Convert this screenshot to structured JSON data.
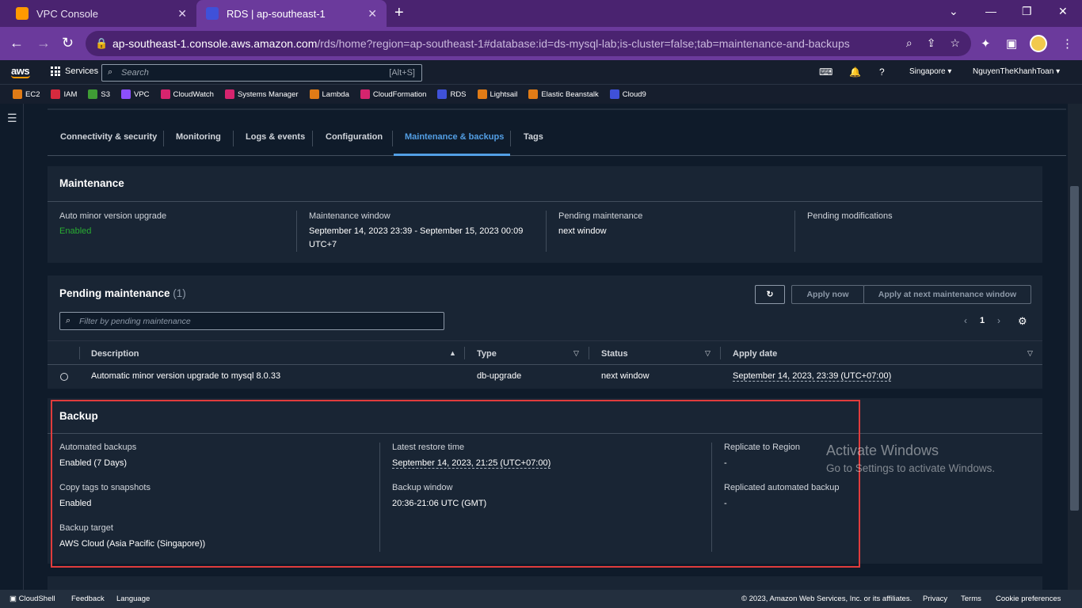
{
  "browser": {
    "tabs": [
      {
        "title": "VPC Console"
      },
      {
        "title": "RDS | ap-southeast-1"
      }
    ],
    "url_host": "ap-southeast-1.console.aws.amazon.com",
    "url_path": "/rds/home?region=ap-southeast-1#database:id=ds-mysql-lab;is-cluster=false;tab=maintenance-and-backups"
  },
  "aws_nav": {
    "logo_text": "aws",
    "services_label": "Services",
    "search_placeholder": "Search",
    "search_shortcut": "[Alt+S]",
    "region": "Singapore ▾",
    "account": "NguyenTheKhanhToan ▾"
  },
  "favorites": [
    "EC2",
    "IAM",
    "S3",
    "VPC",
    "CloudWatch",
    "Systems Manager",
    "Lambda",
    "CloudFormation",
    "RDS",
    "Lightsail",
    "Elastic Beanstalk",
    "Cloud9"
  ],
  "detail_tabs": [
    "Connectivity & security",
    "Monitoring",
    "Logs & events",
    "Configuration",
    "Maintenance & backups",
    "Tags"
  ],
  "maintenance": {
    "title": "Maintenance",
    "auto_minor_label": "Auto minor version upgrade",
    "auto_minor_value": "Enabled",
    "window_label": "Maintenance window",
    "window_value_line1": "September 14, 2023 23:39 - September 15, 2023 00:09",
    "window_value_line2": "UTC+7",
    "pending_label": "Pending maintenance",
    "pending_value": "next window",
    "modifications_label": "Pending modifications"
  },
  "pending": {
    "title": "Pending maintenance",
    "count": "(1)",
    "apply_now": "Apply now",
    "apply_next": "Apply at next maintenance window",
    "filter_placeholder": "Filter by pending maintenance",
    "page": "1",
    "columns": [
      "Description",
      "Type",
      "Status",
      "Apply date"
    ],
    "rows": [
      {
        "description": "Automatic minor version upgrade to mysql 8.0.33",
        "type": "db-upgrade",
        "status": "next window",
        "apply_date": "September 14, 2023, 23:39 (UTC+07:00)"
      }
    ]
  },
  "backup": {
    "title": "Backup",
    "automated_label": "Automated backups",
    "automated_value": "Enabled (7 Days)",
    "copy_tags_label": "Copy tags to snapshots",
    "copy_tags_value": "Enabled",
    "target_label": "Backup target",
    "target_value": "AWS Cloud (Asia Pacific (Singapore))",
    "latest_restore_label": "Latest restore time",
    "latest_restore_value": "September 14, 2023, 21:25 (UTC+07:00)",
    "window_label": "Backup window",
    "window_value": "20:36-21:06 UTC (GMT)",
    "replicate_label": "Replicate to Region",
    "replicate_value": "-",
    "replicated_label": "Replicated automated backup",
    "replicated_value": "-"
  },
  "watermark": {
    "line1": "Activate Windows",
    "line2": "Go to Settings to activate Windows."
  },
  "footer": {
    "cloudshell": "CloudShell",
    "feedback": "Feedback",
    "language": "Language",
    "copyright": "© 2023, Amazon Web Services, Inc. or its affiliates.",
    "privacy": "Privacy",
    "terms": "Terms",
    "cookies": "Cookie preferences"
  },
  "colors": {
    "accent_tab": "#539fe5",
    "enabled_green": "#29ad32",
    "highlight_red": "#e03c3c",
    "browser_purple": "#6b3a9c"
  }
}
